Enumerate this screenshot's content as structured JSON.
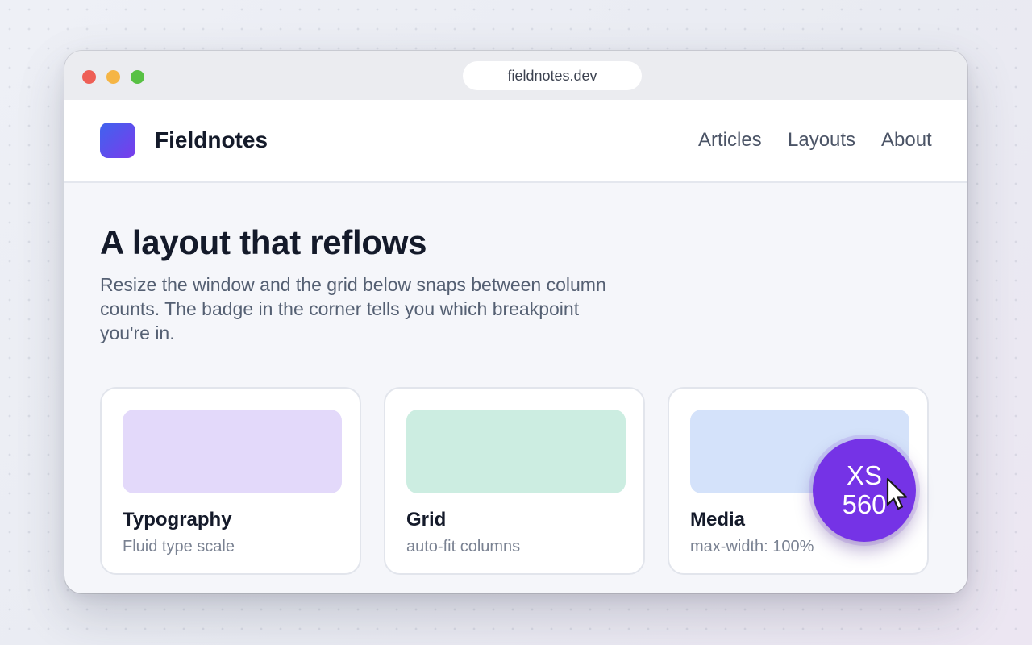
{
  "browser": {
    "url": "fieldnotes.dev"
  },
  "site": {
    "brand": "Fieldnotes",
    "nav": [
      "Articles",
      "Layouts",
      "About"
    ]
  },
  "hero": {
    "title": "A layout that reflows",
    "description": "Resize the window and the grid below snaps between column counts. The badge in the corner tells you which breakpoint you're in."
  },
  "cards": [
    {
      "title": "Typography",
      "subtitle": "Fluid type scale",
      "thumb_color": "#e3d9fa"
    },
    {
      "title": "Grid",
      "subtitle": "auto-fit columns",
      "thumb_color": "#ccede1"
    },
    {
      "title": "Media",
      "subtitle": "max-width: 100%",
      "thumb_color": "#d4e2fa"
    }
  ],
  "badge": {
    "breakpoint": "XS",
    "width": "560",
    "color": "#7533e6"
  },
  "colors": {
    "brand_gradient": [
      "#3f63ee",
      "#7a3cec"
    ],
    "traffic_lights": [
      "#ee5f56",
      "#f5b545",
      "#58c144"
    ]
  }
}
